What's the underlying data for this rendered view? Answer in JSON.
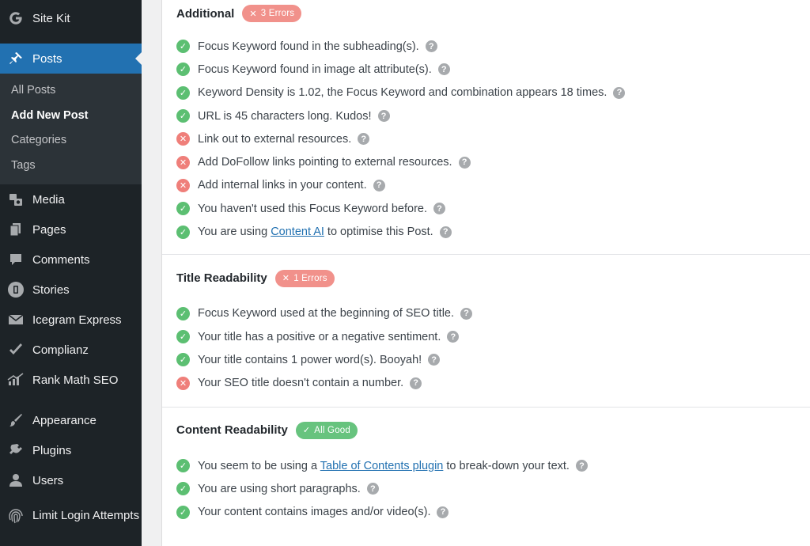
{
  "sidebar": {
    "items": [
      {
        "label": "Site Kit",
        "icon": "google-g-icon"
      },
      {
        "label": "Posts",
        "icon": "pushpin-icon",
        "active": true
      },
      {
        "label": "Media",
        "icon": "media-icon"
      },
      {
        "label": "Pages",
        "icon": "pages-icon"
      },
      {
        "label": "Comments",
        "icon": "comment-icon"
      },
      {
        "label": "Stories",
        "icon": "stories-icon"
      },
      {
        "label": "Icegram Express",
        "icon": "envelope-icon"
      },
      {
        "label": "Complianz",
        "icon": "checkmark-icon"
      },
      {
        "label": "Rank Math SEO",
        "icon": "rank-math-icon"
      },
      {
        "label": "Appearance",
        "icon": "paintbrush-icon"
      },
      {
        "label": "Plugins",
        "icon": "plug-icon"
      },
      {
        "label": "Users",
        "icon": "user-icon"
      },
      {
        "label": "Limit Login Attempts",
        "icon": "fingerprint-icon"
      }
    ],
    "submenu": [
      {
        "label": "All Posts"
      },
      {
        "label": "Add New Post",
        "current": true
      },
      {
        "label": "Categories"
      },
      {
        "label": "Tags"
      }
    ]
  },
  "sections": {
    "additional": {
      "title": "Additional",
      "badge": "3 Errors",
      "tests": [
        {
          "status": "ok",
          "text": "Focus Keyword found in the subheading(s)."
        },
        {
          "status": "ok",
          "text": "Focus Keyword found in image alt attribute(s)."
        },
        {
          "status": "ok",
          "text": "Keyword Density is 1.02, the Focus Keyword and combination appears 18 times."
        },
        {
          "status": "ok",
          "text": "URL is 45 characters long. Kudos!"
        },
        {
          "status": "fail",
          "text": "Link out to external resources."
        },
        {
          "status": "fail",
          "text": "Add DoFollow links pointing to external resources."
        },
        {
          "status": "fail",
          "text": "Add internal links in your content."
        },
        {
          "status": "ok",
          "text": "You haven't used this Focus Keyword before."
        },
        {
          "status": "ok",
          "pre": "You are using ",
          "link": "Content AI",
          "post": " to optimise this Post."
        }
      ]
    },
    "title_readability": {
      "title": "Title Readability",
      "badge": "1 Errors",
      "tests": [
        {
          "status": "ok",
          "text": "Focus Keyword used at the beginning of SEO title."
        },
        {
          "status": "ok",
          "text": "Your title has a positive or a negative sentiment."
        },
        {
          "status": "ok",
          "text": "Your title contains 1 power word(s). Booyah!"
        },
        {
          "status": "fail",
          "text": "Your SEO title doesn't contain a number."
        }
      ]
    },
    "content_readability": {
      "title": "Content Readability",
      "badge": "All Good",
      "tests": [
        {
          "status": "ok",
          "pre": "You seem to be using a ",
          "link": "Table of Contents plugin",
          "post": " to break-down your text."
        },
        {
          "status": "ok",
          "text": "You are using short paragraphs."
        },
        {
          "status": "ok",
          "text": "Your content contains images and/or video(s)."
        }
      ]
    }
  },
  "colors": {
    "sidebar_bg": "#1d2327",
    "active_blue": "#2271b1",
    "ok_green": "#5cbf72",
    "fail_red": "#ef7f7a",
    "error_badge": "#f1918b",
    "good_badge": "#67c37e"
  }
}
